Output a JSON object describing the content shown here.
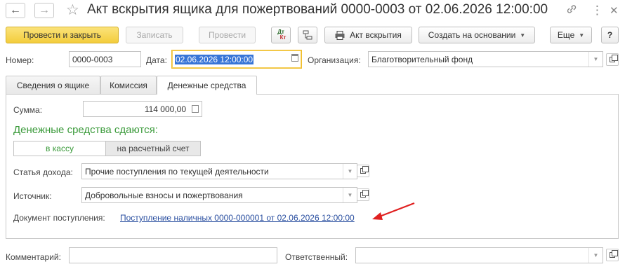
{
  "window": {
    "title": "Акт вскрытия ящика для пожертвований 0000-0003 от 02.06.2026 12:00:00",
    "back_icon": "←",
    "forward_icon": "→",
    "star_icon": "☆",
    "link_icon": "🔗",
    "menu_icon": "⋮",
    "close_icon": "✕"
  },
  "toolbar": {
    "post_and_close": "Провести и закрыть",
    "save": "Записать",
    "post": "Провести",
    "dt_kt_top": "Дт",
    "dt_kt_bottom": "Кт",
    "act_label": "Акт вскрытия",
    "create_based_on": "Создать на основании",
    "more": "Еще",
    "help": "?"
  },
  "header": {
    "number_label": "Номер:",
    "number_value": "0000-0003",
    "date_label": "Дата:",
    "date_value": "02.06.2026 12:00:00",
    "org_label": "Организация:",
    "org_value": "Благотворительный фонд"
  },
  "tabs": [
    {
      "label": "Сведения о ящике"
    },
    {
      "label": "Комиссия"
    },
    {
      "label": "Денежные средства"
    }
  ],
  "money": {
    "sum_label": "Сумма:",
    "sum_value": "114 000,00",
    "handed_title": "Денежные средства сдаются:",
    "option_cash": "в кассу",
    "option_account": "на расчетный счет",
    "income_label": "Статья дохода:",
    "income_value": "Прочие поступления по текущей деятельности",
    "source_label": "Источник:",
    "source_value": "Добровольные взносы и пожертвования",
    "doc_label": "Документ поступления:",
    "doc_link": "Поступление наличных 0000-000001 от 02.06.2026 12:00:00"
  },
  "footer": {
    "comment_label": "Комментарий:",
    "comment_value": "",
    "responsible_label": "Ответственный:",
    "responsible_value": ""
  },
  "colors": {
    "accent_yellow": "#f3cd3c",
    "green_title": "#3a9a3a",
    "link": "#2a4fa0",
    "annotation_arrow": "#e02020"
  }
}
